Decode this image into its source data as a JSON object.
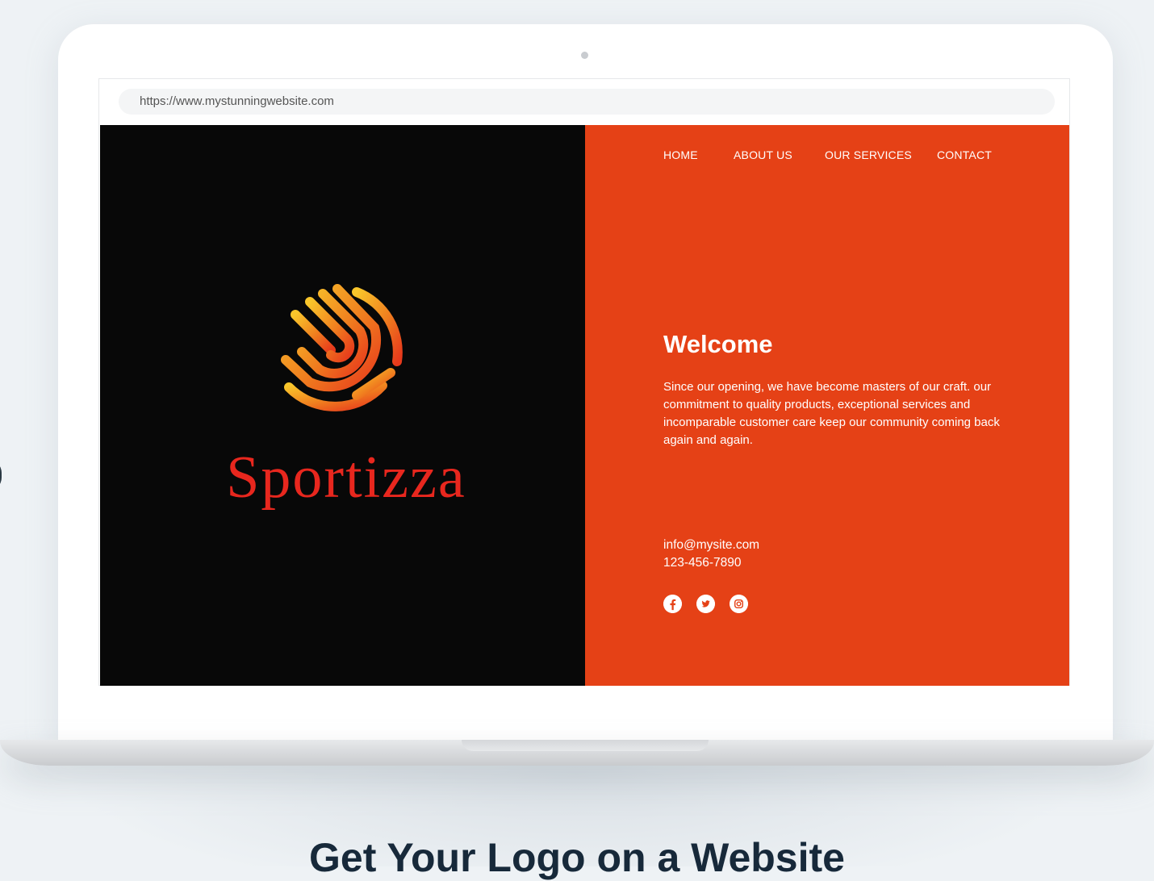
{
  "browser": {
    "url": "https://www.mystunningwebsite.com"
  },
  "site": {
    "brand_name": "Sportizza",
    "nav": [
      "HOME",
      "ABOUT US",
      "OUR SERVICES",
      "CONTACT"
    ],
    "welcome_title": "Welcome",
    "description": "Since our opening, we have become masters of our craft. our commitment to quality products, exceptional services and incomparable customer care keep our community coming back again and again.",
    "email": "info@mysite.com",
    "phone": "123-456-7890",
    "social_icons": [
      "facebook-icon",
      "twitter-icon",
      "instagram-icon"
    ]
  },
  "page": {
    "heading": "Get Your Logo on a Website"
  },
  "colors": {
    "left_panel": "#080808",
    "right_panel": "#e54116",
    "brand_text": "#e8271e",
    "page_bg": "#eef2f5",
    "heading": "#17293a"
  }
}
